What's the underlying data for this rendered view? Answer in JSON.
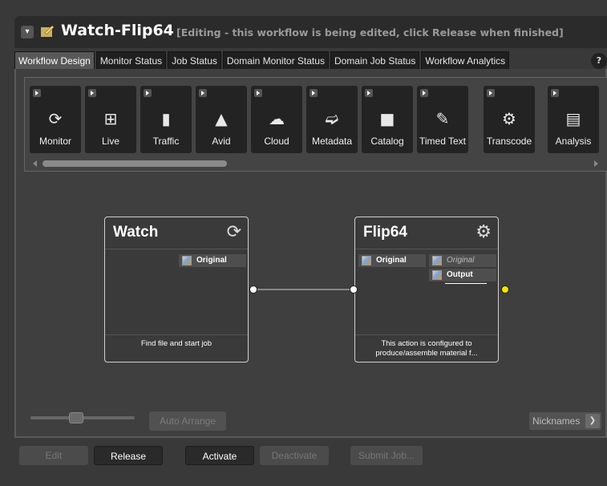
{
  "header": {
    "title": "Watch-Flip64",
    "status": "[Editing - this workflow is being edited, click Release when finished]"
  },
  "tabs": [
    {
      "label": "Workflow Design",
      "active": true
    },
    {
      "label": "Monitor Status"
    },
    {
      "label": "Job Status"
    },
    {
      "label": "Domain Monitor Status"
    },
    {
      "label": "Domain Job Status"
    },
    {
      "label": "Workflow Analytics"
    }
  ],
  "help": "?",
  "palette": {
    "items": [
      {
        "label": "Monitor",
        "icon": "monitor-icon"
      },
      {
        "label": "Live",
        "icon": "live-icon"
      },
      {
        "label": "Traffic",
        "icon": "traffic-icon"
      },
      {
        "label": "Avid",
        "icon": "avid-icon"
      },
      {
        "label": "Cloud",
        "icon": "cloud-icon"
      },
      {
        "label": "Metadata",
        "icon": "paperclip-icon"
      },
      {
        "label": "Catalog",
        "icon": "folder-icon"
      },
      {
        "label": "Timed Text",
        "icon": "timed-text-icon"
      },
      {
        "label": "Transcode",
        "icon": "gear-icon"
      },
      {
        "label": "Analysis",
        "icon": "ruler-icon"
      }
    ]
  },
  "nodes": {
    "watch": {
      "title": "Watch",
      "output_port": "Original",
      "description": "Find file and start job"
    },
    "flip": {
      "title": "Flip64",
      "input_port": "Original",
      "ghost_port": "Original",
      "output_port": "Output",
      "description": "This action is configured to produce/assemble material f..."
    }
  },
  "canvas_toolbar": {
    "auto_arrange": "Auto Arrange",
    "nicknames": "Nicknames"
  },
  "buttons": {
    "edit": "Edit",
    "release": "Release",
    "activate": "Activate",
    "deactivate": "Deactivate",
    "submit_job": "Submit Job..."
  },
  "colors": {
    "output_dot": "#f5e600",
    "connector_dot": "#ffffff"
  }
}
